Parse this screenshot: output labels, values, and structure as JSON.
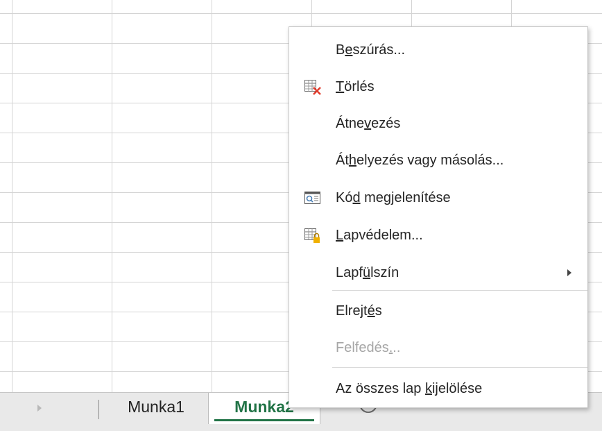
{
  "sheet_tabs": {
    "tab1": "Munka1",
    "tab2": "Munka2"
  },
  "context_menu": {
    "items": [
      {
        "pre": "B",
        "key": "e",
        "post": "szúrás...",
        "icon": "none"
      },
      {
        "pre": "",
        "key": "T",
        "post": "örlés",
        "icon": "delete-sheet-icon"
      },
      {
        "pre": "Átne",
        "key": "v",
        "post": "ezés",
        "icon": "none"
      },
      {
        "pre": "Át",
        "key": "h",
        "post": "elyezés vagy másolás...",
        "icon": "none"
      },
      {
        "pre": "Kó",
        "key": "d",
        "post": " megjelenítése",
        "icon": "view-code-icon"
      },
      {
        "pre": "",
        "key": "L",
        "post": "apvédelem...",
        "icon": "protect-sheet-icon"
      },
      {
        "pre": "Lapf",
        "key": "ü",
        "post": "lszín",
        "icon": "none",
        "submenu": true
      },
      {
        "pre": "Elrejt",
        "key": "é",
        "post": "s",
        "icon": "none"
      },
      {
        "pre": "Felfedés",
        "key": ".",
        "post": "..",
        "icon": "none",
        "disabled": true
      },
      {
        "pre": "Az összes lap ",
        "key": "k",
        "post": "ijelölése",
        "icon": "none"
      }
    ]
  },
  "colors": {
    "active_tab_text": "#217346",
    "delete_icon_x": "#e03a2b",
    "lock_icon": "#f0b000"
  }
}
